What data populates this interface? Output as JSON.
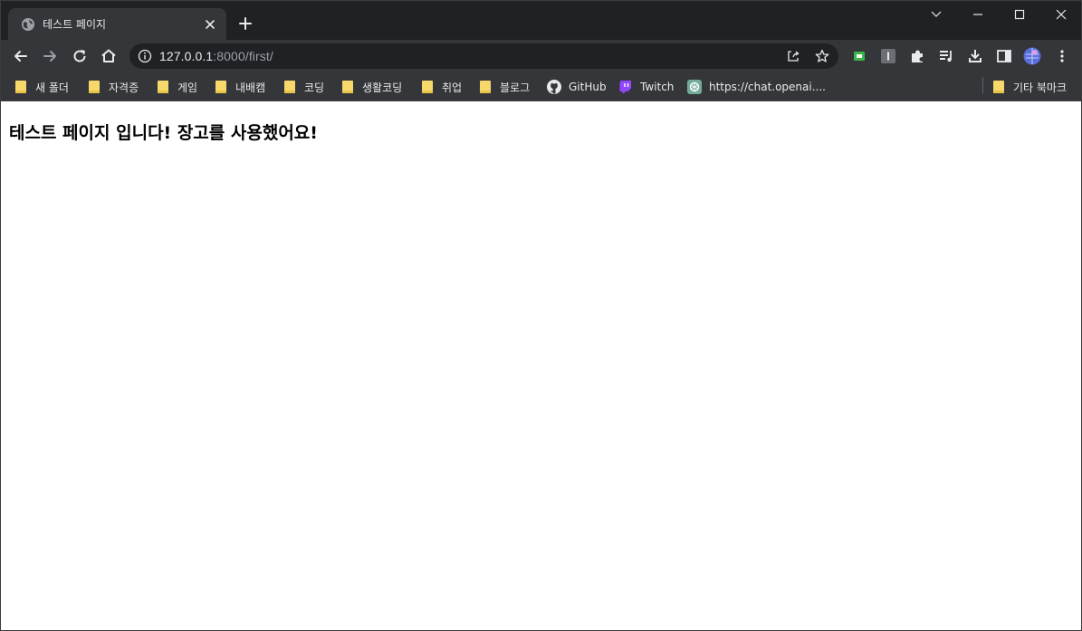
{
  "tab": {
    "title": "테스트 페이지",
    "favicon": "globe-icon"
  },
  "address_bar": {
    "url_host": "127.0.0.1",
    "url_rest": ":8000/first/"
  },
  "bookmarks": [
    {
      "label": "새 폴더",
      "icon": "folder-icon"
    },
    {
      "label": "자격증",
      "icon": "folder-icon"
    },
    {
      "label": "게임",
      "icon": "folder-icon"
    },
    {
      "label": "내배캠",
      "icon": "folder-icon"
    },
    {
      "label": "코딩",
      "icon": "folder-icon"
    },
    {
      "label": "생활코딩",
      "icon": "folder-icon"
    },
    {
      "label": "취업",
      "icon": "folder-icon"
    },
    {
      "label": "블로그",
      "icon": "folder-icon"
    },
    {
      "label": "GitHub",
      "icon": "github-icon"
    },
    {
      "label": "Twitch",
      "icon": "twitch-icon"
    },
    {
      "label": "https://chat.openai....",
      "icon": "openai-icon"
    }
  ],
  "other_bookmarks": {
    "label": "기타 북마크",
    "icon": "folder-icon"
  },
  "page": {
    "heading": "테스트 페이지 입니다! 장고를 사용했어요!"
  },
  "colors": {
    "frame": "#202124",
    "toolbar": "#35363a",
    "page_bg": "#ffffff",
    "folder": "#f6d86b"
  }
}
